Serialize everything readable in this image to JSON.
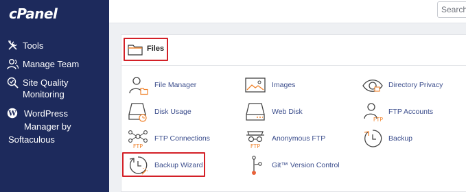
{
  "sidebar": {
    "brand": "cPanel",
    "items": [
      {
        "label": "Tools",
        "icon": "tools-icon"
      },
      {
        "label": "Manage Team",
        "icon": "users-icon"
      },
      {
        "label": "Site Quality\nMonitoring",
        "icon": "site-quality-icon"
      }
    ],
    "wordpress": {
      "line1": "WordPress",
      "line2": "Manager by",
      "line3": "Softaculous",
      "icon": "wordpress-icon"
    }
  },
  "header": {
    "search_placeholder": "Search"
  },
  "section": {
    "title": "Files",
    "icon": "folder-icon"
  },
  "tools": [
    {
      "label": "File Manager",
      "icon": "file-manager-icon"
    },
    {
      "label": "Images",
      "icon": "images-icon"
    },
    {
      "label": "Directory Privacy",
      "icon": "directory-privacy-icon"
    },
    {
      "label": "Disk Usage",
      "icon": "disk-usage-icon"
    },
    {
      "label": "Web Disk",
      "icon": "web-disk-icon"
    },
    {
      "label": "FTP Accounts",
      "icon": "ftp-accounts-icon"
    },
    {
      "label": "FTP Connections",
      "icon": "ftp-connections-icon",
      "badge": "FTP"
    },
    {
      "label": "Anonymous FTP",
      "icon": "anonymous-ftp-icon",
      "badge": "FTP"
    },
    {
      "label": "Backup",
      "icon": "backup-icon"
    },
    {
      "label": "Backup Wizard",
      "icon": "backup-wizard-icon"
    },
    {
      "label": "Git™ Version Control",
      "icon": "git-icon"
    }
  ],
  "colors": {
    "sidebar": "#1d2a5c",
    "link": "#3b4d8c",
    "highlight": "#d32027",
    "accent": "#f0822b"
  }
}
